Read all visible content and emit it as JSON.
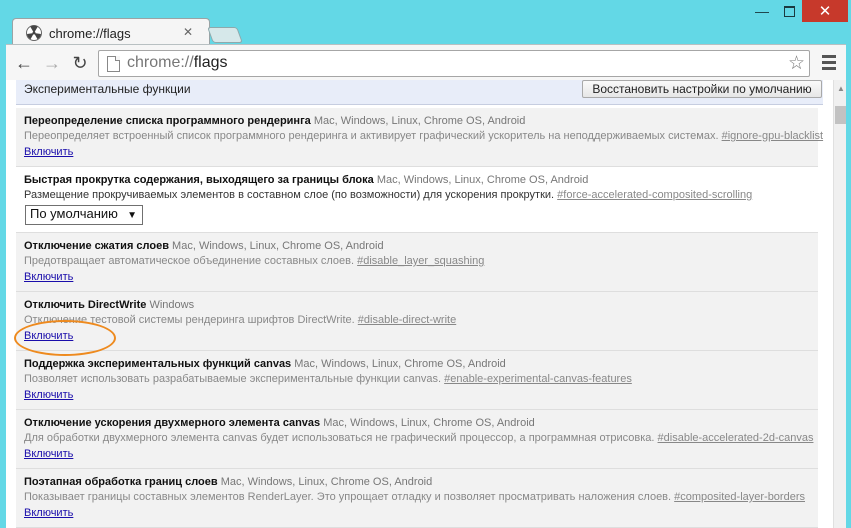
{
  "tab": {
    "title": "chrome://flags",
    "icon": "radioactive-icon"
  },
  "address_bar": {
    "scheme": "chrome://",
    "path": "flags"
  },
  "page": {
    "header_title": "Экспериментальные функции",
    "reset_button": "Восстановить настройки по умолчанию"
  },
  "experiments": [
    {
      "name": "Переопределение списка программного рендеринга",
      "platforms": "Mac, Windows, Linux, Chrome OS, Android",
      "description": "Переопределяет встроенный список программного рендеринга и активирует графический ускоритель на неподдерживаемых системах.",
      "flag": "#ignore-gpu-blacklist",
      "action": "Включить"
    },
    {
      "name": "Быстрая прокрутка содержания, выходящего за границы блока",
      "platforms": "Mac, Windows, Linux, Chrome OS, Android",
      "description": "Размещение прокручиваемых элементов в составном слое (по возможности) для ускорения прокрутки.",
      "flag": "#force-accelerated-composited-scrolling",
      "select_value": "По умолчанию"
    },
    {
      "name": "Отключение сжатия слоев",
      "platforms": "Mac, Windows, Linux, Chrome OS, Android",
      "description": "Предотвращает автоматическое объединение составных слоев.",
      "flag": "#disable_layer_squashing",
      "action": "Включить"
    },
    {
      "name": "Отключить DirectWrite",
      "platforms": "Windows",
      "description": "Отключение тестовой системы рендеринга шрифтов DirectWrite.",
      "flag": "#disable-direct-write",
      "action": "Включить"
    },
    {
      "name": "Поддержка экспериментальных функций canvas",
      "platforms": "Mac, Windows, Linux, Chrome OS, Android",
      "description": "Позволяет использовать разрабатываемые экспериментальные функции canvas.",
      "flag": "#enable-experimental-canvas-features",
      "action": "Включить"
    },
    {
      "name": "Отключение ускорения двухмерного элемента canvas",
      "platforms": "Mac, Windows, Linux, Chrome OS, Android",
      "description": "Для обработки двухмерного элемента canvas будет использоваться не графический процессор, а программная отрисовка.",
      "flag": "#disable-accelerated-2d-canvas",
      "action": "Включить"
    },
    {
      "name": "Поэтапная обработка границ слоев",
      "platforms": "Mac, Windows, Linux, Chrome OS, Android",
      "description": "Показывает границы составных элементов RenderLayer. Это упрощает отладку и позволяет просматривать наложения слоев.",
      "flag": "#composited-layer-borders",
      "action": "Включить"
    }
  ],
  "colors": {
    "accent_annotation": "#ee8a1e",
    "link": "#1a0dab",
    "frame": "#63d8e6",
    "close": "#c7392b"
  }
}
